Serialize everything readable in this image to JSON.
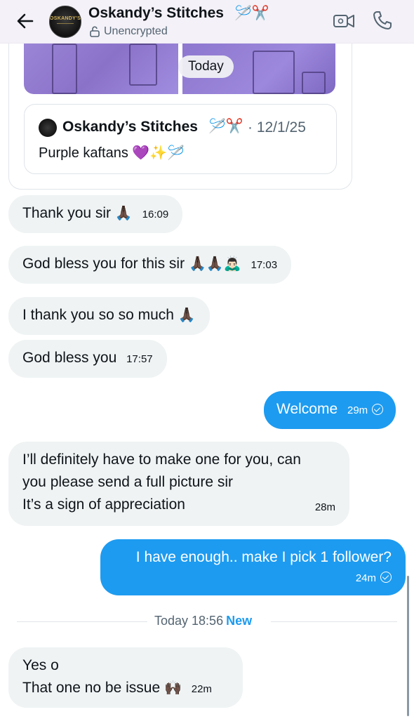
{
  "header": {
    "title": "Oskandy’s Stitches",
    "title_emoji": "🪡✂️",
    "status": "Unencrypted",
    "avatar_text": "OSKANDY'S"
  },
  "shared_post": {
    "today_pill": "Today",
    "quote": {
      "author": "Oskandy’s Stitches",
      "author_emoji": "🪡✂️",
      "date": "· 12/1/25",
      "text": "Purple kaftans 💜✨🪡"
    }
  },
  "messages": [
    {
      "direction": "in",
      "text": "Thank you sir",
      "emoji": "🙏🏿",
      "time": "16:09"
    },
    {
      "direction": "in",
      "text": "God bless you for this sir",
      "emoji": "🙏🏿🙏🏿🙇🏻‍♂️",
      "time": "17:03"
    },
    {
      "direction": "in",
      "text": "I thank you so so much",
      "emoji": "🙏🏿",
      "time": ""
    },
    {
      "direction": "in",
      "text": "God bless you",
      "emoji": "",
      "time": "17:57"
    },
    {
      "direction": "out",
      "text": "Welcome",
      "time": "29m"
    },
    {
      "direction": "in",
      "lines": [
        "I’ll definitely have to make one for you, can",
        "you please send a full picture sir",
        "It’s a sign of appreciation"
      ],
      "time": "28m"
    },
    {
      "direction": "out",
      "text": "I have enough.. make I pick 1 follower?",
      "time": "24m"
    },
    {
      "direction": "in",
      "lines": [
        "Yes o",
        "That one no be issue"
      ],
      "emoji": "🙌🏿",
      "time": "22m"
    }
  ],
  "divider": {
    "label": "Today 18:56",
    "new_label": "New"
  }
}
